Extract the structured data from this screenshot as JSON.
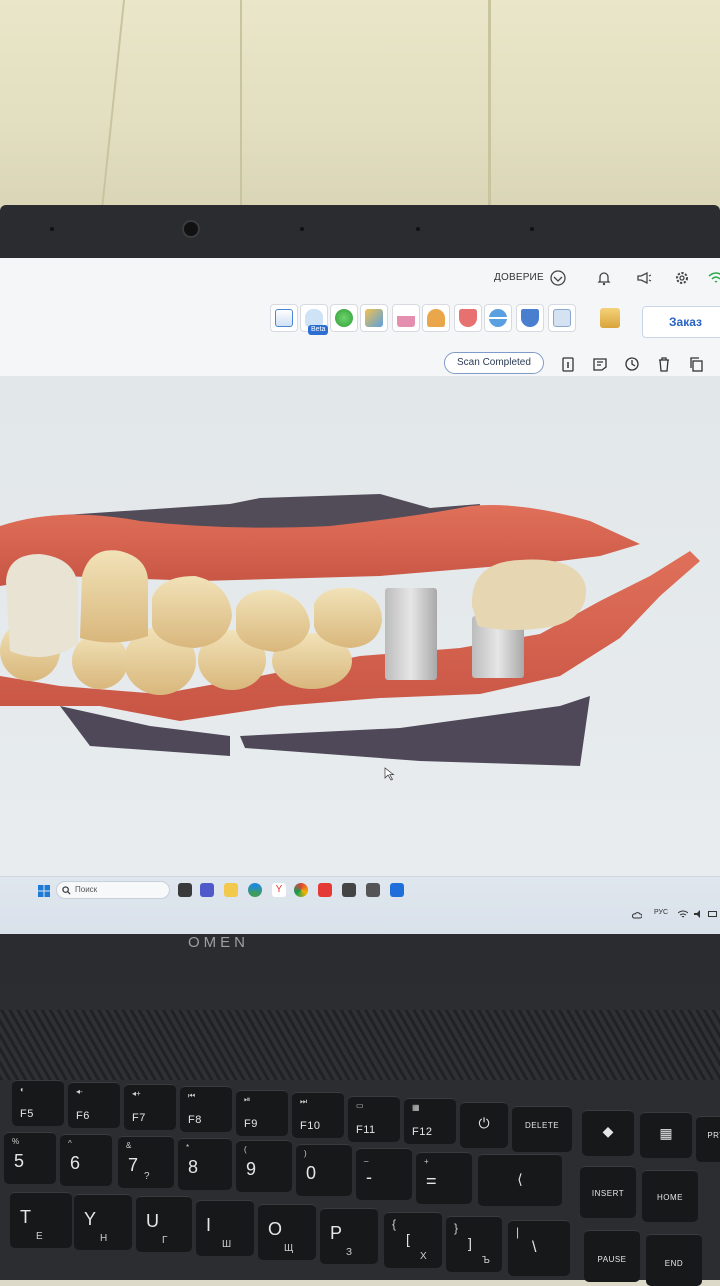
{
  "topbar": {
    "trust_label": "ДОВЕРИЕ"
  },
  "toolbar": {
    "tools": [
      {
        "name": "scanner-tool",
        "color": "#4a86d6"
      },
      {
        "name": "tooth-scan-tool",
        "color": "#7bb3e6"
      },
      {
        "name": "shade-tool",
        "color": "#4cbf58"
      },
      {
        "name": "analysis-tool",
        "color": "#e0a23a"
      },
      {
        "name": "margin-tool",
        "color": "#d77a9c"
      },
      {
        "name": "upper-jaw-tool",
        "color": "#e0a04a"
      },
      {
        "name": "lower-jaw-tool",
        "color": "#e06a6a"
      },
      {
        "name": "bite-tool",
        "color": "#5aa0e0"
      },
      {
        "name": "impression-tool",
        "color": "#4a7fd0"
      },
      {
        "name": "model-tool",
        "color": "#b8cfe8"
      },
      {
        "name": "print-tool",
        "color": "#e8b84a"
      }
    ],
    "beta_label": "Beta",
    "order_label": "Заказ"
  },
  "actions": {
    "status_label": "Scan Completed"
  },
  "taskbar": {
    "search_placeholder": "Поиск",
    "lang": "РУС"
  },
  "brand": "OMEN",
  "keyboard": {
    "fkeys": [
      "F5",
      "F6",
      "F7",
      "F8",
      "F9",
      "F10",
      "F11",
      "F12"
    ],
    "delete": "DELETE",
    "insert": "INSERT",
    "home": "HOME",
    "pause": "PAUSE",
    "end": "END",
    "prt": "PRT",
    "num_row": [
      {
        "top": "%",
        "main": "5"
      },
      {
        "top": "^",
        "main": "6"
      },
      {
        "top": "&",
        "main": "7",
        "alt": "?"
      },
      {
        "top": "*",
        "main": "8"
      },
      {
        "top": "(",
        "main": "9"
      },
      {
        "top": ")",
        "main": "0"
      },
      {
        "top": "_",
        "main": "-"
      },
      {
        "top": "+",
        "main": "="
      }
    ],
    "letter_row": [
      {
        "main": "T",
        "cy": "Е"
      },
      {
        "main": "Y",
        "cy": "Н"
      },
      {
        "main": "U",
        "cy": "Г"
      },
      {
        "main": "I",
        "cy": "Ш"
      },
      {
        "main": "O",
        "cy": "Щ"
      },
      {
        "main": "P",
        "cy": "З"
      },
      {
        "main": "{",
        "alt": "[",
        "cy": "Х"
      },
      {
        "main": "}",
        "alt": "]",
        "cy": "Ъ"
      },
      {
        "main": "|",
        "alt": "\\"
      }
    ]
  }
}
